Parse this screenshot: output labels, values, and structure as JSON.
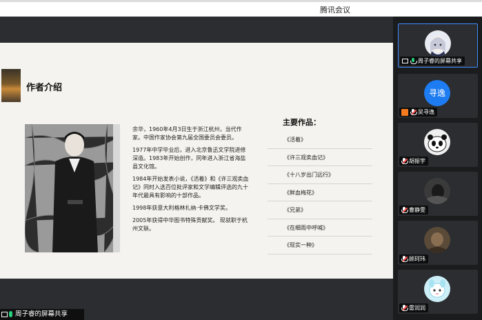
{
  "app": {
    "title": "腾讯会议"
  },
  "slide": {
    "heading": "作者介绍",
    "bio": [
      "余华，1960年4月3日生于浙江杭州，当代作家。中国作家协会第九届全国委员会委员。",
      "1977年中学毕业后，进入北京鲁迅文学院进修深造。1983年开始创作，同年进入浙江省海盐县文化馆。",
      "1984年开始发表小说，《活着》和《许三观卖血记》同时入选百位批评家和文学编辑评选的九十年代最具有影响的十部作品。",
      "1998年获意大利格林扎纳·卡佛文学奖。",
      "2005年获得中华图书特殊贡献奖。 现就职于杭州文联。"
    ],
    "works_title": "主要作品：",
    "works": [
      "《活着》",
      "《许三观卖血记》",
      "《十八岁出门远行》",
      "《鲜血梅花》",
      "《兄弟》",
      "《在细雨中呼喊》",
      "《现实一种》"
    ]
  },
  "share_label": "周子睿的屏幕共享",
  "participants": [
    {
      "name": "周子睿的屏幕共享",
      "avatar": "anime-icon",
      "mic": "on",
      "sharing": true,
      "active": true
    },
    {
      "name": "吴寻逸",
      "avatar_text": "寻逸",
      "mic": "muted",
      "badge": "orange"
    },
    {
      "name": "胡振宇",
      "avatar": "panda-icon",
      "mic": "muted"
    },
    {
      "name": "曹静雯",
      "avatar": "dark-photo-icon",
      "mic": "muted"
    },
    {
      "name": "顾珂玮",
      "avatar": "brown-photo-icon",
      "mic": "muted"
    },
    {
      "name": "雷润润",
      "avatar": "cartoon-icon",
      "mic": "muted"
    }
  ],
  "colors": {
    "accent": "#1e7cf3",
    "mic_on": "#26d07c",
    "muted": "#ff4b4b",
    "sidebar_bg": "#1b1c1e"
  }
}
